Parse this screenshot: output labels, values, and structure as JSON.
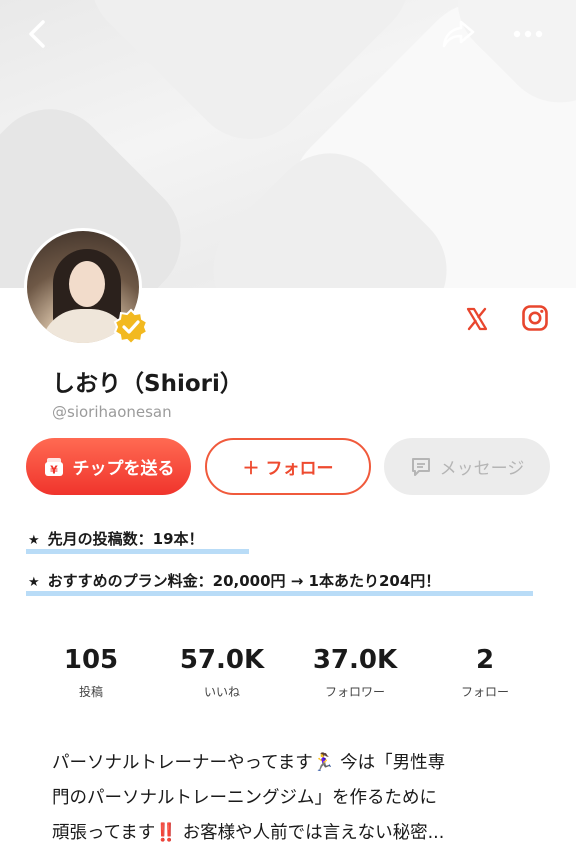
{
  "cover": {
    "image": "cover-pattern"
  },
  "header": {
    "back_icon": "chevron-left-icon",
    "share_icon": "share-arrow-icon",
    "more_icon": "more-dots-icon"
  },
  "profile": {
    "avatar": "profile-photo",
    "verified": true,
    "display_name": "しおり（Shiori）",
    "handle": "@siorihaonesan",
    "social": [
      "x-icon",
      "instagram-icon"
    ]
  },
  "actions": {
    "tip_label": "チップを送る",
    "follow_label": "＋ フォロー",
    "message_label": "メッセージ"
  },
  "notes": [
    {
      "star": "★",
      "text": "先月の投稿数：19本！"
    },
    {
      "star": "★",
      "text": "おすすめのプラン料金：20,000円 → 1本あたり204円！"
    }
  ],
  "stats": [
    {
      "value": "105",
      "label": "投稿"
    },
    {
      "value": "57.0K",
      "label": "いいね"
    },
    {
      "value": "37.0K",
      "label": "フォロワー"
    },
    {
      "value": "2",
      "label": "フォロー"
    }
  ],
  "bio": {
    "line1": "パーソナルトレーナーやってます🏃‍♀️ 今は「男性専",
    "line2": "門のパーソナルトレーニングジム」を作るために",
    "line3": "頑張ってます‼️ お客様や人前では言えない秘密..."
  },
  "colors": {
    "accent": "#f0342c",
    "follow_border": "#f05a3c",
    "underline": "#b9dcf7",
    "badge": "#f2b920"
  }
}
